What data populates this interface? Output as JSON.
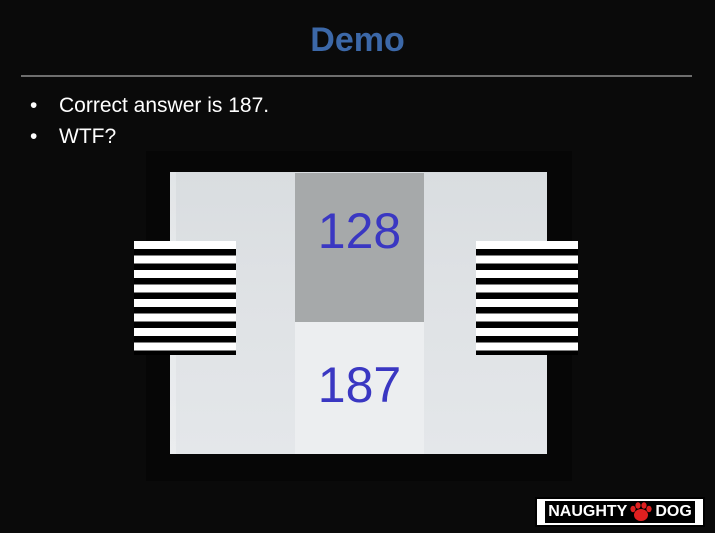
{
  "slide": {
    "title": "Demo",
    "bullets": [
      "Correct answer is 187.",
      "WTF?"
    ],
    "bullet_glyph": "•"
  },
  "demo_image": {
    "top_value": "128",
    "bottom_value": "187"
  },
  "logo": {
    "left_text": "NAUGHTY",
    "right_text": "DOG",
    "icon": "paw-icon"
  },
  "colors": {
    "background": "#0a0a0a",
    "title": "#3c68a8",
    "bullet_text": "#ffffff",
    "number_text": "#3a37c2",
    "upper_panel": "#a6a9aa",
    "lower_panel": "#eceef0",
    "logo_paw": "#e02020"
  }
}
